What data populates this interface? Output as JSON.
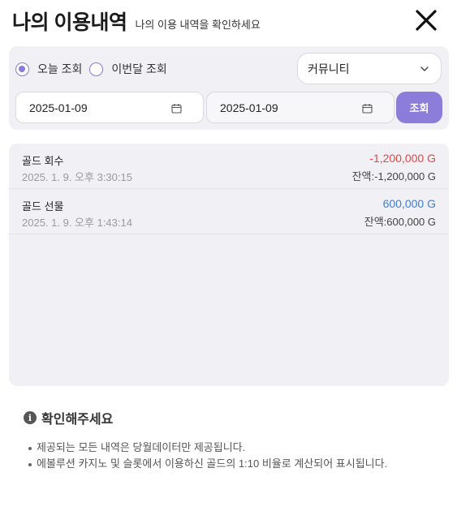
{
  "header": {
    "title": "나의 이용내역",
    "subtitle": "나의 이용 내역을 확인하세요",
    "close_icon": "close-icon"
  },
  "filters": {
    "radio_options": [
      {
        "label": "오늘 조회",
        "checked": true
      },
      {
        "label": "이번달 조회",
        "checked": false
      }
    ],
    "category_select": {
      "value": "커뮤니티",
      "icon": "chevron-down-icon"
    },
    "start_date": "2025-01-09",
    "end_date": "2025-01-09",
    "calendar_icon": "calendar-icon",
    "search_label": "조회",
    "accent_color": "#8c7ddb"
  },
  "transactions": [
    {
      "name": "골드 회수",
      "time": "2025. 1. 9. 오후 3:30:15",
      "amount": "-1,200,000 G",
      "balance": "잔액:-1,200,000 G",
      "type": "negative"
    },
    {
      "name": "골드 선물",
      "time": "2025. 1. 9. 오후 1:43:14",
      "amount": "600,000 G",
      "balance": "잔액:600,000 G",
      "type": "positive"
    }
  ],
  "colors": {
    "negative": "#e84545",
    "positive": "#3a7ee0"
  },
  "notice": {
    "icon": "info-icon",
    "title": "확인해주세요",
    "items": [
      "제공되는 모든 내역은 당월데이터만 제공됩니다.",
      "에볼루션 카지노 및 슬롯에서 이용하신 골드의 1:10 비율로 계산되어 표시됩니다."
    ]
  }
}
